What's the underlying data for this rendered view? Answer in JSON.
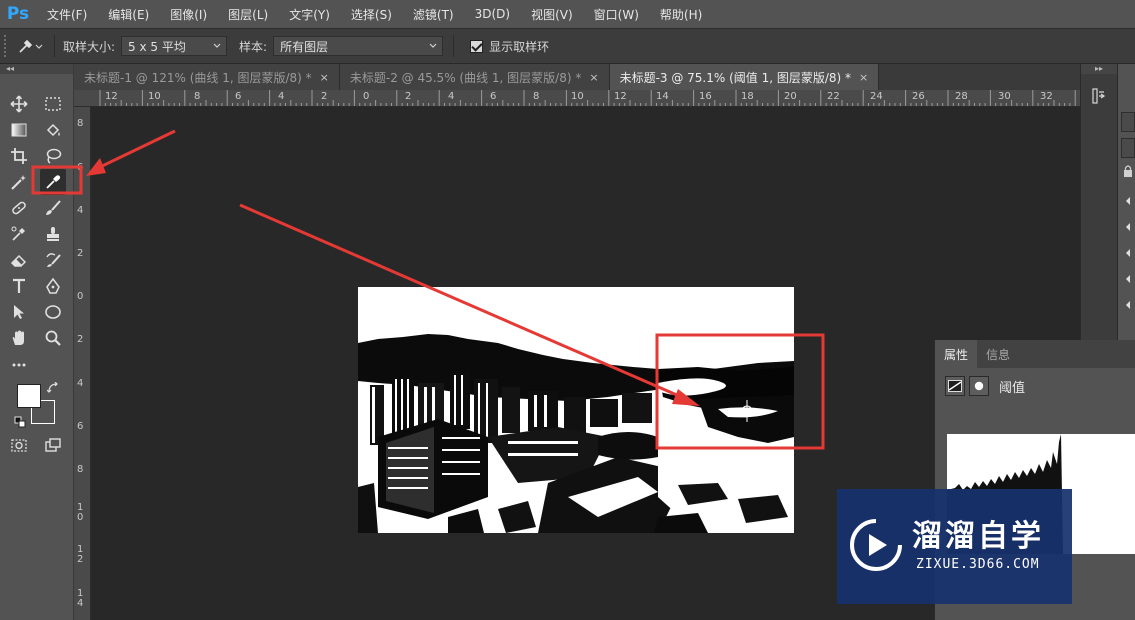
{
  "app": {
    "logo": "Ps",
    "menu": [
      "文件(F)",
      "编辑(E)",
      "图像(I)",
      "图层(L)",
      "文字(Y)",
      "选择(S)",
      "滤镜(T)",
      "3D(D)",
      "视图(V)",
      "窗口(W)",
      "帮助(H)"
    ]
  },
  "options": {
    "sample_size_label": "取样大小:",
    "sample_size_value": "5 x 5 平均",
    "sample_label": "样本:",
    "sample_value": "所有图层",
    "show_ring_label": "显示取样环",
    "show_ring_checked": true
  },
  "tabs": [
    {
      "label": "未标题-1 @ 121% (曲线 1, 图层蒙版/8) *",
      "close": "×",
      "active": false
    },
    {
      "label": "未标题-2 @ 45.5% (曲线 1, 图层蒙版/8) *",
      "close": "×",
      "active": false
    },
    {
      "label": "未标题-3 @ 75.1% (阈值 1, 图层蒙版/8) *",
      "close": "×",
      "active": true
    }
  ],
  "ruler_top": [
    "12",
    "10",
    "8",
    "6",
    "4",
    "2",
    "0",
    "2",
    "4",
    "6",
    "8",
    "10",
    "12",
    "14",
    "16",
    "18",
    "20",
    "22",
    "24",
    "26",
    "28",
    "30",
    "32"
  ],
  "ruler_left": [
    "8",
    "6",
    "4",
    "2",
    "0",
    "2",
    "4",
    "6",
    "8",
    "1\n0",
    "1\n2",
    "1\n4"
  ],
  "panel": {
    "tabs": [
      "属性",
      "信息"
    ],
    "title": "阈值"
  },
  "watermark": {
    "title": "溜溜自学",
    "subtitle": "ZIXUE.3D66.COM"
  },
  "colors": {
    "accent_red": "#e53935",
    "ps_blue": "#31a8ff",
    "watermark_bg": "#18326e"
  }
}
